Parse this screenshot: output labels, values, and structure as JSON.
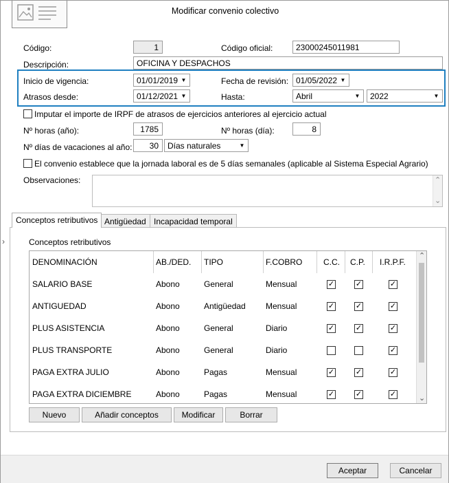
{
  "window": {
    "title": "Modificar convenio colectivo"
  },
  "fields": {
    "codigo_label": "Código:",
    "codigo_value": "1",
    "codigo_oficial_label": "Código oficial:",
    "codigo_oficial_value": "23000245011981",
    "descripcion_label": "Descripción:",
    "descripcion_value": "OFICINA Y DESPACHOS",
    "inicio_label": "Inicio de vigencia:",
    "inicio_value": "01/01/2019",
    "revision_label": "Fecha de revisión:",
    "revision_value": "01/05/2022",
    "atrasos_label": "Atrasos desde:",
    "atrasos_value": "01/12/2021",
    "hasta_label": "Hasta:",
    "hasta_mes": "Abril",
    "hasta_anio": "2022",
    "imputar_label": "Imputar el importe de IRPF de atrasos de ejercicios anteriores al ejercicio actual",
    "horas_anio_label": "Nº horas (año):",
    "horas_anio_value": "1785",
    "horas_dia_label": "Nº horas (día):",
    "horas_dia_value": "8",
    "vacaciones_label": "Nº días de vacaciones al año:",
    "vacaciones_value": "30",
    "vacaciones_tipo": "Días naturales",
    "jornada_label": "El convenio establece que la jornada laboral es de 5 días semanales (aplicable al Sistema Especial Agrario)",
    "observaciones_label": "Observaciones:"
  },
  "tabs": [
    "Conceptos retributivos",
    "Antigüedad",
    "Incapacidad temporal"
  ],
  "grid": {
    "title": "Conceptos retributivos",
    "headers": [
      "DENOMINACIÓN",
      "AB./DED.",
      "TIPO",
      "F.COBRO",
      "C.C.",
      "C.P.",
      "I.R.P.F."
    ],
    "rows": [
      {
        "denominacion": "SALARIO BASE",
        "ab": "Abono",
        "tipo": "General",
        "cobro": "Mensual",
        "cc": true,
        "cp": true,
        "irpf": true
      },
      {
        "denominacion": "ANTIGUEDAD",
        "ab": "Abono",
        "tipo": "Antigüedad",
        "cobro": "Mensual",
        "cc": true,
        "cp": true,
        "irpf": true
      },
      {
        "denominacion": "PLUS ASISTENCIA",
        "ab": "Abono",
        "tipo": "General",
        "cobro": "Diario",
        "cc": true,
        "cp": true,
        "irpf": true
      },
      {
        "denominacion": "PLUS TRANSPORTE",
        "ab": "Abono",
        "tipo": "General",
        "cobro": "Diario",
        "cc": false,
        "cp": false,
        "irpf": true
      },
      {
        "denominacion": "PAGA EXTRA JULIO",
        "ab": "Abono",
        "tipo": "Pagas",
        "cobro": "Mensual",
        "cc": true,
        "cp": true,
        "irpf": true
      },
      {
        "denominacion": "PAGA EXTRA DICIEMBRE",
        "ab": "Abono",
        "tipo": "Pagas",
        "cobro": "Mensual",
        "cc": true,
        "cp": true,
        "irpf": true
      }
    ]
  },
  "grid_buttons": {
    "nuevo": "Nuevo",
    "anadir": "Añadir conceptos",
    "modificar": "Modificar",
    "borrar": "Borrar"
  },
  "footer": {
    "aceptar": "Aceptar",
    "cancelar": "Cancelar"
  },
  "glyphs": {
    "check": "✓",
    "dropdown": "▼",
    "scroll_up": "⌃",
    "scroll_down": "⌄",
    "side_arrow": "›"
  }
}
